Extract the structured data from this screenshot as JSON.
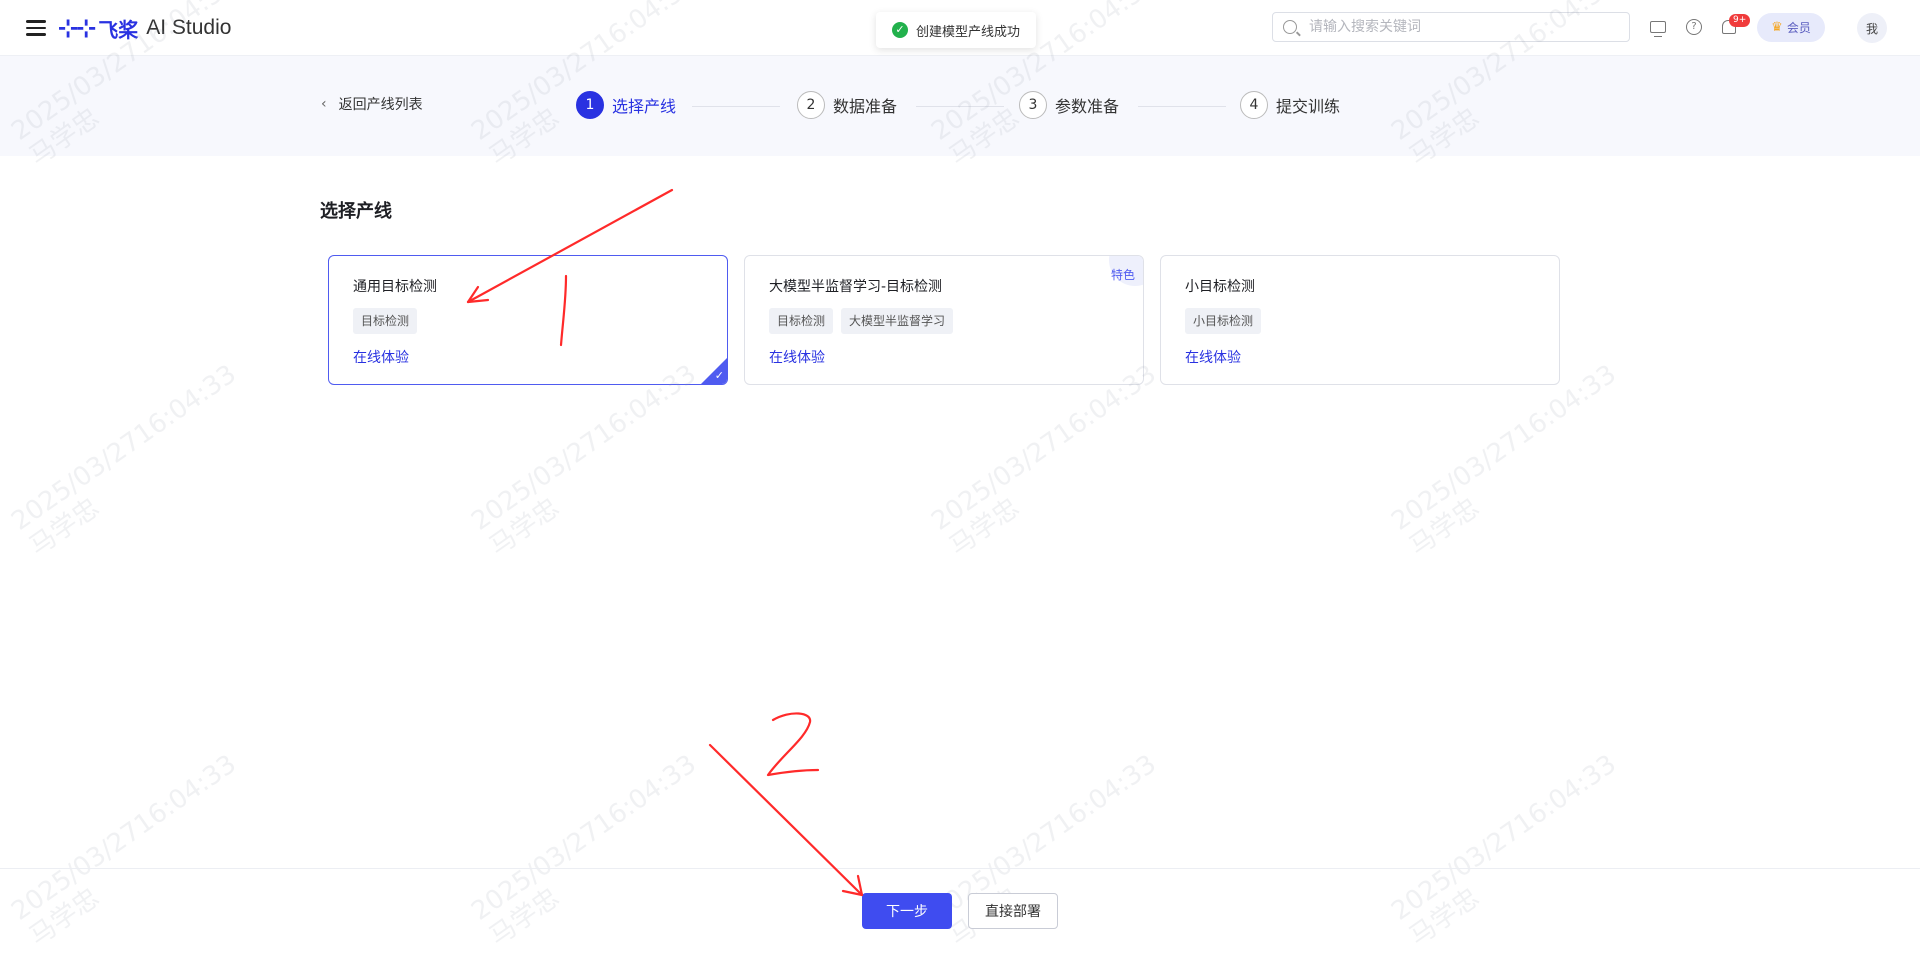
{
  "header": {
    "logo_mark": "飞桨",
    "logo_cn": "飞桨",
    "logo_en": "AI Studio",
    "toast": "创建模型产线成功",
    "search_placeholder": "请输入搜索关键词",
    "notification_badge": "9+",
    "vip_label": "会员",
    "avatar_label": "我"
  },
  "steps_nav": {
    "back_label": "返回产线列表",
    "steps": [
      {
        "num": "1",
        "label": "选择产线"
      },
      {
        "num": "2",
        "label": "数据准备"
      },
      {
        "num": "3",
        "label": "参数准备"
      },
      {
        "num": "4",
        "label": "提交训练"
      }
    ]
  },
  "main": {
    "section_title": "选择产线",
    "cards": [
      {
        "title": "通用目标检测",
        "tags": [
          "目标检测"
        ],
        "link": "在线体验",
        "selected": true
      },
      {
        "title": "大模型半监督学习-目标检测",
        "tags": [
          "目标检测",
          "大模型半监督学习"
        ],
        "link": "在线体验",
        "badge": "特色"
      },
      {
        "title": "小目标检测",
        "tags": [
          "小目标检测"
        ],
        "link": "在线体验"
      }
    ]
  },
  "footer": {
    "next_label": "下一步",
    "deploy_label": "直接部署"
  },
  "watermark": {
    "line1": "2025/03/2716:04:33",
    "line2": "马学忠"
  },
  "annotations": {
    "label_1": "1",
    "label_2": "2",
    "color": "#ff2a2a"
  }
}
